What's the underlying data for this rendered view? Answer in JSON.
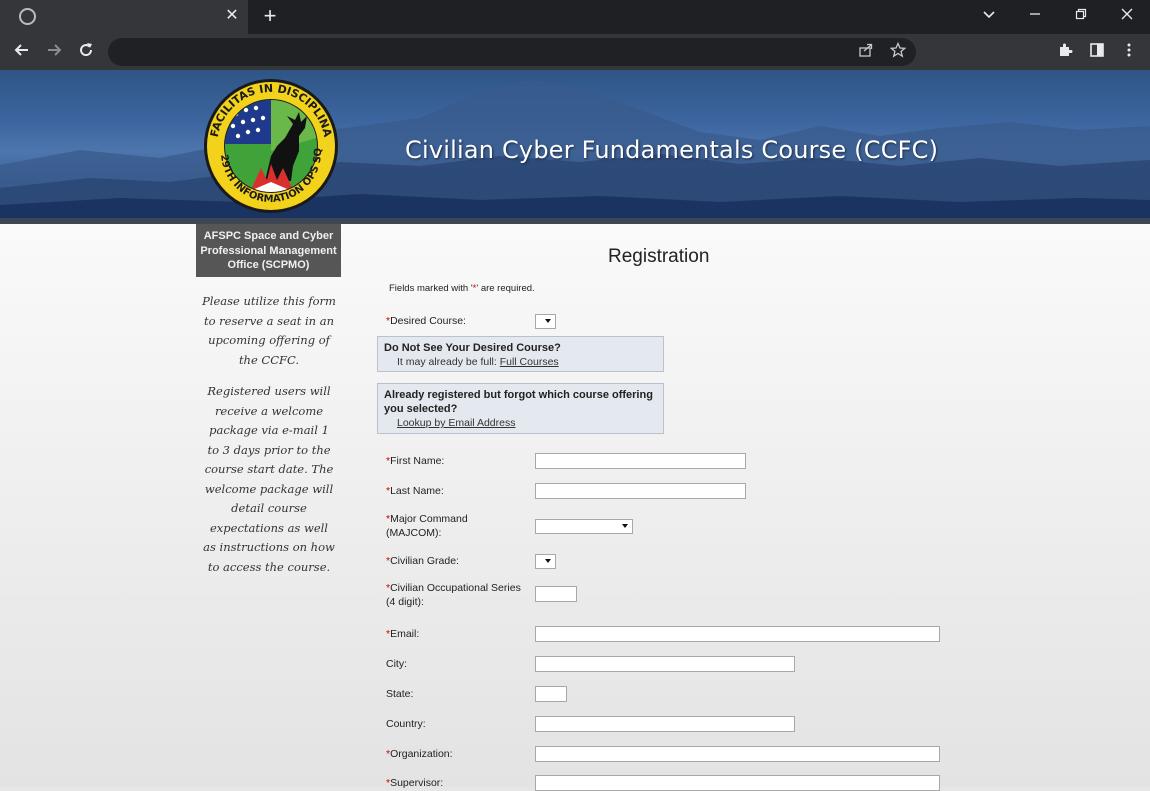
{
  "browser": {
    "tab_close": "✕",
    "new_tab": "+"
  },
  "banner": {
    "title": "Civilian Cyber Fundamentals Course (CCFC)",
    "emblem_text_top": "FACILITAS IN DISCIPLINA",
    "emblem_text_bottom": "229TH INFORMATION OPS SQ"
  },
  "sidebar": {
    "box_line1": "AFSPC Space and Cyber",
    "box_line2": "Professional Management",
    "box_line3": "Office (SCPMO)",
    "para1": "Please utilize this form to reserve a seat in an upcoming offering of the CCFC.",
    "para2": "Registered users will receive a welcome package via e-mail 1 to 3 days prior to the course start date. The welcome package will detail course expectations as well as instructions on how to access the course."
  },
  "form": {
    "title": "Registration",
    "required_note_pre": "Fields marked with '",
    "required_star": "*",
    "required_note_post": "' are required.",
    "desired_course_label": "Desired Course:",
    "not_see_heading": "Do Not See Your Desired Course?",
    "not_see_text": "It may already be full: ",
    "full_courses_link": "Full Courses",
    "forgot_heading": "Already registered but forgot which course offering you selected?",
    "lookup_link": "Lookup by Email Address",
    "first_name_label": "First Name:",
    "last_name_label": "Last Name:",
    "majcom_label_1": "Major Command",
    "majcom_label_2": "(MAJCOM):",
    "grade_label": "Civilian Grade:",
    "series_label_1": "Civilian Occupational Series",
    "series_label_2": "(4 digit):",
    "email_label": "Email:",
    "city_label": "City:",
    "state_label": "State:",
    "country_label": "Country:",
    "organization_label": "Organization:",
    "supervisor_label": "Supervisor:"
  },
  "colors": {
    "required": "#cc0000",
    "sidebar_box": "#565656",
    "info_box": "#e4e9ef"
  }
}
